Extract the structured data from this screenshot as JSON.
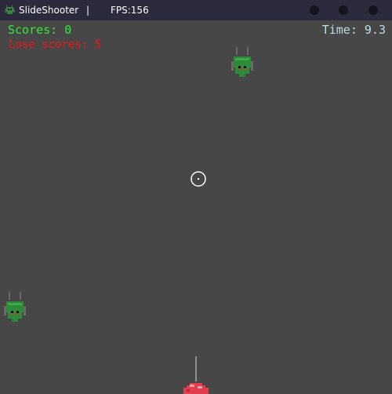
{
  "window": {
    "title": "SlideShooter",
    "separator": "|",
    "fps": "FPS:156"
  },
  "hud": {
    "scores": "Scores: 0",
    "lose_scores": "Lose scores: 5",
    "time": "Time: 9.3"
  },
  "colors": {
    "background": "#474747",
    "titlebar": "#2b2b3d",
    "scores": "#35e83a",
    "lose_scores": "#f21414",
    "time": "#b9dfe6",
    "enemy_body": "#2f8a3a",
    "player_ship": "#e03e4e"
  },
  "icons": {
    "app": "green-bug-icon",
    "enemy": "green-bug-enemy",
    "player": "red-ship",
    "aim": "crosshair-icon"
  }
}
